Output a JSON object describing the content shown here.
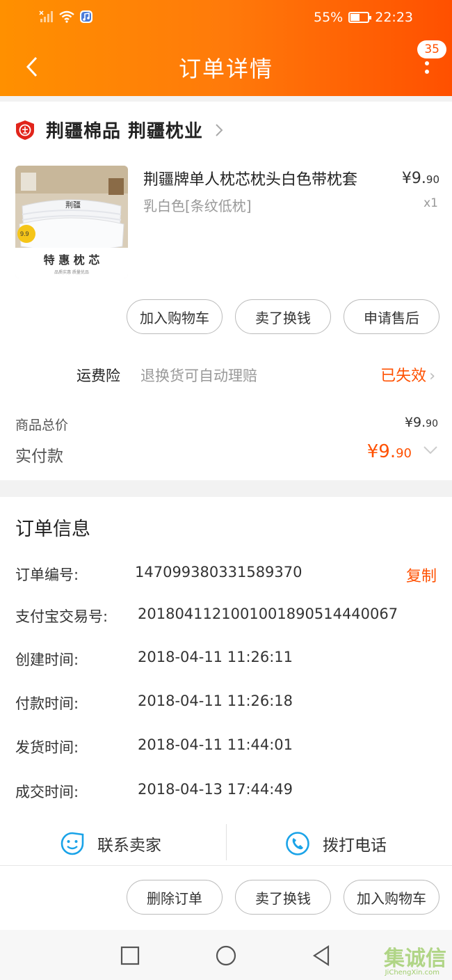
{
  "status_bar": {
    "battery": "55%",
    "time": "22:23"
  },
  "header": {
    "title": "订单详情",
    "badge_count": "35"
  },
  "shop": {
    "name": "荆疆棉品  荆疆枕业"
  },
  "product": {
    "title": "荆疆牌单人枕芯枕头白色带枕套",
    "sku": "乳白色[条纹低枕]",
    "price_main": "¥9.",
    "price_decimal": "90",
    "qty": "x1",
    "image_price_tag": "9.9",
    "image_caption": "特 惠 枕 芯",
    "image_subcaption": "品质实惠  质量优品",
    "image_brand_text": "荆疆"
  },
  "actions_top": {
    "add_cart": "加入购物车",
    "sell": "卖了换钱",
    "after_sale": "申请售后"
  },
  "insurance": {
    "label": "运费险",
    "desc": "退换货可自动理赔",
    "status": "已失效"
  },
  "totals": {
    "goods_label": "商品总价",
    "goods_main": "¥9.",
    "goods_decimal": "90",
    "paid_label": "实付款",
    "paid_main": "¥9.",
    "paid_decimal": "90"
  },
  "order_info": {
    "title": "订单信息",
    "copy": "复制",
    "rows": [
      {
        "label": "订单编号:",
        "value": "147099380331589370"
      },
      {
        "label": "支付宝交易号:",
        "value": "2018041121001001890514440067"
      },
      {
        "label": "创建时间:",
        "value": "2018-04-11 11:26:11"
      },
      {
        "label": "付款时间:",
        "value": "2018-04-11 11:26:18"
      },
      {
        "label": "发货时间:",
        "value": "2018-04-11 11:44:01"
      },
      {
        "label": "成交时间:",
        "value": "2018-04-13 17:44:49"
      }
    ]
  },
  "contact": {
    "seller": "联系卖家",
    "phone": "拨打电话"
  },
  "actions_bottom": {
    "delete": "删除订单",
    "sell": "卖了换钱",
    "add_cart": "加入购物车"
  },
  "watermark": {
    "text": "集诚信",
    "sub": "JiChengXin.com"
  },
  "colors": {
    "accent": "#ff5000",
    "header_start": "#ff9000",
    "header_end": "#ff5000"
  }
}
